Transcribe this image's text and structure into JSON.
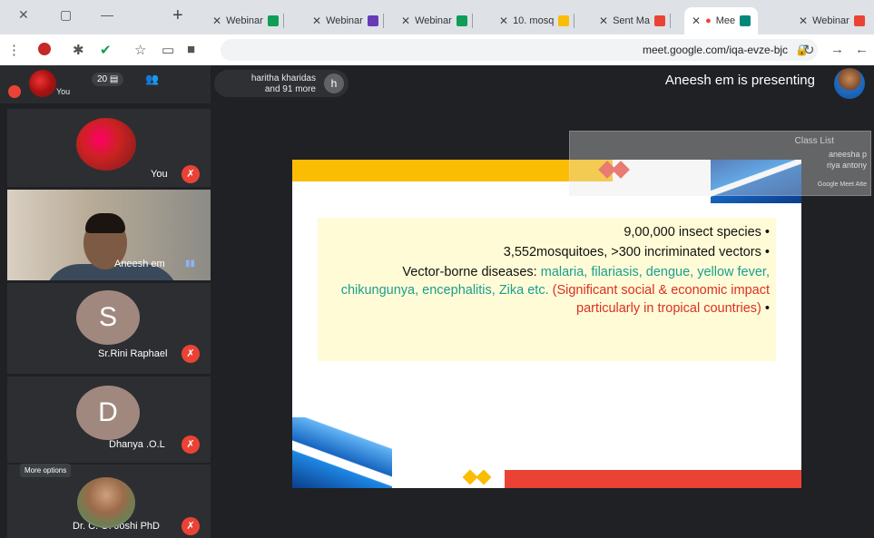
{
  "tabs": [
    {
      "label": "Webinar",
      "favicon_color": "#ea4335"
    },
    {
      "label": "Mee",
      "favicon_color": "#00897b",
      "active": true
    },
    {
      "label": "Sent Ma",
      "favicon_color": "#ea4335"
    },
    {
      "label": "10. mosq",
      "favicon_color": "#fbbc04"
    },
    {
      "label": "Webinar",
      "favicon_color": "#0f9d58"
    },
    {
      "label": "Webinar",
      "favicon_color": "#673ab7"
    },
    {
      "label": "Webinar",
      "favicon_color": "#0f9d58"
    },
    {
      "label": "Webinar",
      "favicon_color": "#0f9d58"
    }
  ],
  "address": "meet.google.com/iqa-evze-bjc",
  "meet": {
    "presenting_text": "Aneesh em is presenting",
    "speaker_chip": {
      "initial": "h",
      "line1": "haritha kharidas",
      "line2": "and 91 more"
    },
    "participant_count": "20",
    "you_label": "You",
    "participants": [
      {
        "name": "You"
      },
      {
        "name": "Aneesh em"
      },
      {
        "name": "Sr.Rini Raphael",
        "initial": "S"
      },
      {
        "name": "Dhanya .O.L",
        "initial": "D"
      },
      {
        "name": "Dr. C. O. Joshi PhD"
      }
    ],
    "tooltip": "More options"
  },
  "overlay": {
    "title": "Class List",
    "lines": [
      "aneesha p",
      "riya antony",
      "Google Meet Atte"
    ]
  },
  "slide": {
    "bullet1": "9,00,000 insect species",
    "bullet2": "3,552mosquitoes, >300 incriminated vectors",
    "bullet3_lead": "Vector-borne diseases:",
    "bullet3_teal": "malaria, filariasis, dengue, yellow fever, chikungunya, encephalitis, Zika etc.",
    "bullet3_red": "(Significant social & economic impact particularly in tropical countries)"
  }
}
